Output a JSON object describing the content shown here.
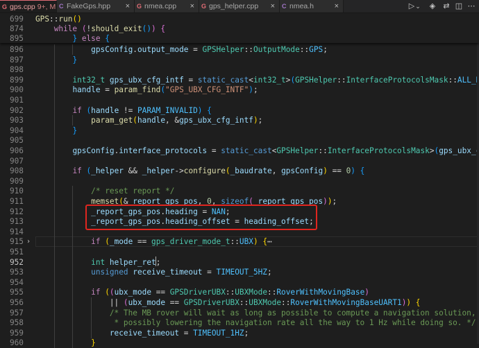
{
  "tabs": [
    {
      "name": "gps.cpp",
      "badge": "9+, M",
      "icon_glyph": "G",
      "icon_color": "#e06c75",
      "active": true
    },
    {
      "name": "FakeGps.hpp",
      "badge": "",
      "icon_glyph": "C",
      "icon_color": "#a074c4",
      "active": false
    },
    {
      "name": "nmea.cpp",
      "badge": "",
      "icon_glyph": "G",
      "icon_color": "#e06c75",
      "active": false
    },
    {
      "name": "gps_helper.cpp",
      "badge": "",
      "icon_glyph": "G",
      "icon_color": "#e06c75",
      "active": false
    },
    {
      "name": "nmea.h",
      "badge": "",
      "icon_glyph": "C",
      "icon_color": "#a074c4",
      "active": false
    }
  ],
  "tab_close_glyph": "×",
  "tab_actions": {
    "run_glyph": "▷",
    "run_dropdown_glyph": "⌄",
    "copilot_glyph": "◈",
    "compare_glyph": "⇄",
    "split_glyph": "◫",
    "more_glyph": "⋯"
  },
  "sticky_lines": [
    {
      "line": "699",
      "tokens": [
        [
          "fn",
          "GPS"
        ],
        [
          "pu",
          "::"
        ],
        [
          "fn",
          "run"
        ],
        [
          "br",
          "()"
        ]
      ]
    },
    {
      "line": "874",
      "tokens": [
        [
          "pu",
          "    "
        ],
        [
          "ctl",
          "while"
        ],
        [
          "pu",
          " "
        ],
        [
          "pk",
          "("
        ],
        [
          "pu",
          "!"
        ],
        [
          "fn",
          "should_exit"
        ],
        [
          "bb",
          "()"
        ],
        [
          "pk",
          ")"
        ],
        [
          "pu",
          " "
        ],
        [
          "pk",
          "{"
        ]
      ]
    },
    {
      "line": "895",
      "tokens": [
        [
          "pu",
          "        "
        ],
        [
          "bb",
          "}"
        ],
        [
          "pu",
          " "
        ],
        [
          "ctl",
          "else"
        ],
        [
          "pu",
          " "
        ],
        [
          "bb",
          "{"
        ]
      ]
    }
  ],
  "code_lines": [
    {
      "line": "896",
      "tokens": [
        [
          "pu",
          "            "
        ],
        [
          "v",
          "gpsConfig"
        ],
        [
          "pu",
          "."
        ],
        [
          "v",
          "output_mode"
        ],
        [
          "pu",
          " = "
        ],
        [
          "ty",
          "GPSHelper"
        ],
        [
          "pu",
          "::"
        ],
        [
          "ty",
          "OutputMode"
        ],
        [
          "pu",
          "::"
        ],
        [
          "cs",
          "GPS"
        ],
        [
          "pu",
          ";"
        ]
      ]
    },
    {
      "line": "897",
      "tokens": [
        [
          "pu",
          "        "
        ],
        [
          "bb",
          "}"
        ]
      ]
    },
    {
      "line": "898",
      "tokens": []
    },
    {
      "line": "899",
      "tokens": [
        [
          "pu",
          "        "
        ],
        [
          "ty",
          "int32_t"
        ],
        [
          "pu",
          " "
        ],
        [
          "v",
          "gps_ubx_cfg_intf"
        ],
        [
          "pu",
          " = "
        ],
        [
          "kw",
          "static_cast"
        ],
        [
          "pu",
          "<"
        ],
        [
          "ty",
          "int32_t"
        ],
        [
          "pu",
          ">"
        ],
        [
          "bb",
          "("
        ],
        [
          "ty",
          "GPSHelper"
        ],
        [
          "pu",
          "::"
        ],
        [
          "ty",
          "InterfaceProtocolsMask"
        ],
        [
          "pu",
          "::"
        ],
        [
          "cs",
          "ALL_DIS"
        ]
      ]
    },
    {
      "line": "900",
      "tokens": [
        [
          "pu",
          "        "
        ],
        [
          "v",
          "handle"
        ],
        [
          "pu",
          " = "
        ],
        [
          "fn",
          "param_find"
        ],
        [
          "bb",
          "("
        ],
        [
          "st",
          "\"GPS_UBX_CFG_INTF\""
        ],
        [
          "bb",
          ")"
        ],
        [
          "pu",
          ";"
        ]
      ]
    },
    {
      "line": "901",
      "tokens": []
    },
    {
      "line": "902",
      "tokens": [
        [
          "pu",
          "        "
        ],
        [
          "ctl",
          "if"
        ],
        [
          "pu",
          " "
        ],
        [
          "bb",
          "("
        ],
        [
          "v",
          "handle"
        ],
        [
          "pu",
          " != "
        ],
        [
          "cs",
          "PARAM_INVALID"
        ],
        [
          "bb",
          ")"
        ],
        [
          "pu",
          " "
        ],
        [
          "bb",
          "{"
        ]
      ]
    },
    {
      "line": "903",
      "tokens": [
        [
          "pu",
          "            "
        ],
        [
          "fn",
          "param_get"
        ],
        [
          "br",
          "("
        ],
        [
          "v",
          "handle"
        ],
        [
          "pu",
          ", &"
        ],
        [
          "v",
          "gps_ubx_cfg_intf"
        ],
        [
          "br",
          ")"
        ],
        [
          "pu",
          ";"
        ]
      ]
    },
    {
      "line": "904",
      "tokens": [
        [
          "pu",
          "        "
        ],
        [
          "bb",
          "}"
        ]
      ]
    },
    {
      "line": "905",
      "tokens": []
    },
    {
      "line": "906",
      "tokens": [
        [
          "pu",
          "        "
        ],
        [
          "v",
          "gpsConfig"
        ],
        [
          "pu",
          "."
        ],
        [
          "v",
          "interface_protocols"
        ],
        [
          "pu",
          " = "
        ],
        [
          "kw",
          "static_cast"
        ],
        [
          "pu",
          "<"
        ],
        [
          "ty",
          "GPSHelper"
        ],
        [
          "pu",
          "::"
        ],
        [
          "ty",
          "InterfaceProtocolsMask"
        ],
        [
          "pu",
          ">"
        ],
        [
          "bb",
          "("
        ],
        [
          "v",
          "gps_ubx_cfg"
        ]
      ]
    },
    {
      "line": "907",
      "tokens": []
    },
    {
      "line": "908",
      "tokens": [
        [
          "pu",
          "        "
        ],
        [
          "ctl",
          "if"
        ],
        [
          "pu",
          " "
        ],
        [
          "bb",
          "("
        ],
        [
          "v",
          "_helper"
        ],
        [
          "pu",
          " && "
        ],
        [
          "v",
          "_helper"
        ],
        [
          "pu",
          "->"
        ],
        [
          "fn",
          "configure"
        ],
        [
          "br",
          "("
        ],
        [
          "v",
          "_baudrate"
        ],
        [
          "pu",
          ", "
        ],
        [
          "v",
          "gpsConfig"
        ],
        [
          "br",
          ")"
        ],
        [
          "pu",
          " == "
        ],
        [
          "nu",
          "0"
        ],
        [
          "bb",
          ")"
        ],
        [
          "pu",
          " "
        ],
        [
          "bb",
          "{"
        ]
      ]
    },
    {
      "line": "909",
      "tokens": []
    },
    {
      "line": "910",
      "tokens": [
        [
          "pu",
          "            "
        ],
        [
          "cm",
          "/* reset report */"
        ]
      ]
    },
    {
      "line": "911",
      "tokens": [
        [
          "pu",
          "            "
        ],
        [
          "fn",
          "memset"
        ],
        [
          "br",
          "("
        ],
        [
          "pu",
          "&"
        ],
        [
          "v",
          "_report_gps_pos"
        ],
        [
          "pu",
          ", "
        ],
        [
          "nu",
          "0"
        ],
        [
          "pu",
          ", "
        ],
        [
          "kw",
          "sizeof"
        ],
        [
          "pk",
          "("
        ],
        [
          "v",
          "_report_gps_pos"
        ],
        [
          "pk",
          ")"
        ],
        [
          "br",
          ")"
        ],
        [
          "pu",
          ";"
        ]
      ]
    },
    {
      "line": "912",
      "tokens": [
        [
          "pu",
          "            "
        ],
        [
          "v",
          "_report_gps_pos"
        ],
        [
          "pu",
          "."
        ],
        [
          "v",
          "heading"
        ],
        [
          "pu",
          " = "
        ],
        [
          "cs",
          "NAN"
        ],
        [
          "pu",
          ";"
        ]
      ]
    },
    {
      "line": "913",
      "tokens": [
        [
          "pu",
          "            "
        ],
        [
          "v",
          "_report_gps_pos"
        ],
        [
          "pu",
          "."
        ],
        [
          "v",
          "heading_offset"
        ],
        [
          "pu",
          " = "
        ],
        [
          "v",
          "heading_offset"
        ],
        [
          "pu",
          ";"
        ]
      ]
    },
    {
      "line": "914",
      "tokens": []
    },
    {
      "line": "915",
      "fold": true,
      "tokens": [
        [
          "pu",
          "            "
        ],
        [
          "ctl",
          "if"
        ],
        [
          "pu",
          " "
        ],
        [
          "br",
          "("
        ],
        [
          "v",
          "_mode"
        ],
        [
          "pu",
          " == "
        ],
        [
          "ty",
          "gps_driver_mode_t"
        ],
        [
          "pu",
          "::"
        ],
        [
          "cs",
          "UBX"
        ],
        [
          "br",
          ")"
        ],
        [
          "pu",
          " "
        ],
        [
          "br",
          "{"
        ],
        [
          "pu",
          "⋯"
        ]
      ]
    },
    {
      "line": "951",
      "tokens": []
    },
    {
      "line": "952",
      "current": true,
      "tokens": [
        [
          "pu",
          "            "
        ],
        [
          "ty",
          "int"
        ],
        [
          "pu",
          " "
        ],
        [
          "v",
          "helper_ret"
        ],
        [
          "pu",
          ";"
        ]
      ]
    },
    {
      "line": "953",
      "tokens": [
        [
          "pu",
          "            "
        ],
        [
          "kw",
          "unsigned"
        ],
        [
          "pu",
          " "
        ],
        [
          "v",
          "receive_timeout"
        ],
        [
          "pu",
          " = "
        ],
        [
          "cs",
          "TIMEOUT_5HZ"
        ],
        [
          "pu",
          ";"
        ]
      ]
    },
    {
      "line": "954",
      "tokens": []
    },
    {
      "line": "955",
      "tokens": [
        [
          "pu",
          "            "
        ],
        [
          "ctl",
          "if"
        ],
        [
          "pu",
          " "
        ],
        [
          "br",
          "("
        ],
        [
          "pk",
          "("
        ],
        [
          "v",
          "ubx_mode"
        ],
        [
          "pu",
          " == "
        ],
        [
          "ty",
          "GPSDriverUBX"
        ],
        [
          "pu",
          "::"
        ],
        [
          "ty",
          "UBXMode"
        ],
        [
          "pu",
          "::"
        ],
        [
          "cs",
          "RoverWithMovingBase"
        ],
        [
          "pk",
          ")"
        ]
      ]
    },
    {
      "line": "956",
      "tokens": [
        [
          "pu",
          "                "
        ],
        [
          "pu",
          "|| "
        ],
        [
          "pk",
          "("
        ],
        [
          "v",
          "ubx_mode"
        ],
        [
          "pu",
          " == "
        ],
        [
          "ty",
          "GPSDriverUBX"
        ],
        [
          "pu",
          "::"
        ],
        [
          "ty",
          "UBXMode"
        ],
        [
          "pu",
          "::"
        ],
        [
          "cs",
          "RoverWithMovingBaseUART1"
        ],
        [
          "pk",
          ")"
        ],
        [
          "br",
          ")"
        ],
        [
          "pu",
          " "
        ],
        [
          "br",
          "{"
        ]
      ]
    },
    {
      "line": "957",
      "tokens": [
        [
          "pu",
          "                "
        ],
        [
          "cm",
          "/* The MB rover will wait as long as possible to compute a navigation solution,"
        ]
      ]
    },
    {
      "line": "958",
      "tokens": [
        [
          "pu",
          "                "
        ],
        [
          "cm",
          " * possibly lowering the navigation rate all the way to 1 Hz while doing so. */"
        ]
      ]
    },
    {
      "line": "959",
      "tokens": [
        [
          "pu",
          "                "
        ],
        [
          "v",
          "receive_timeout"
        ],
        [
          "pu",
          " = "
        ],
        [
          "cs",
          "TIMEOUT_1HZ"
        ],
        [
          "pu",
          ";"
        ]
      ]
    },
    {
      "line": "960",
      "tokens": [
        [
          "pu",
          "            "
        ],
        [
          "br",
          "}"
        ]
      ]
    }
  ]
}
